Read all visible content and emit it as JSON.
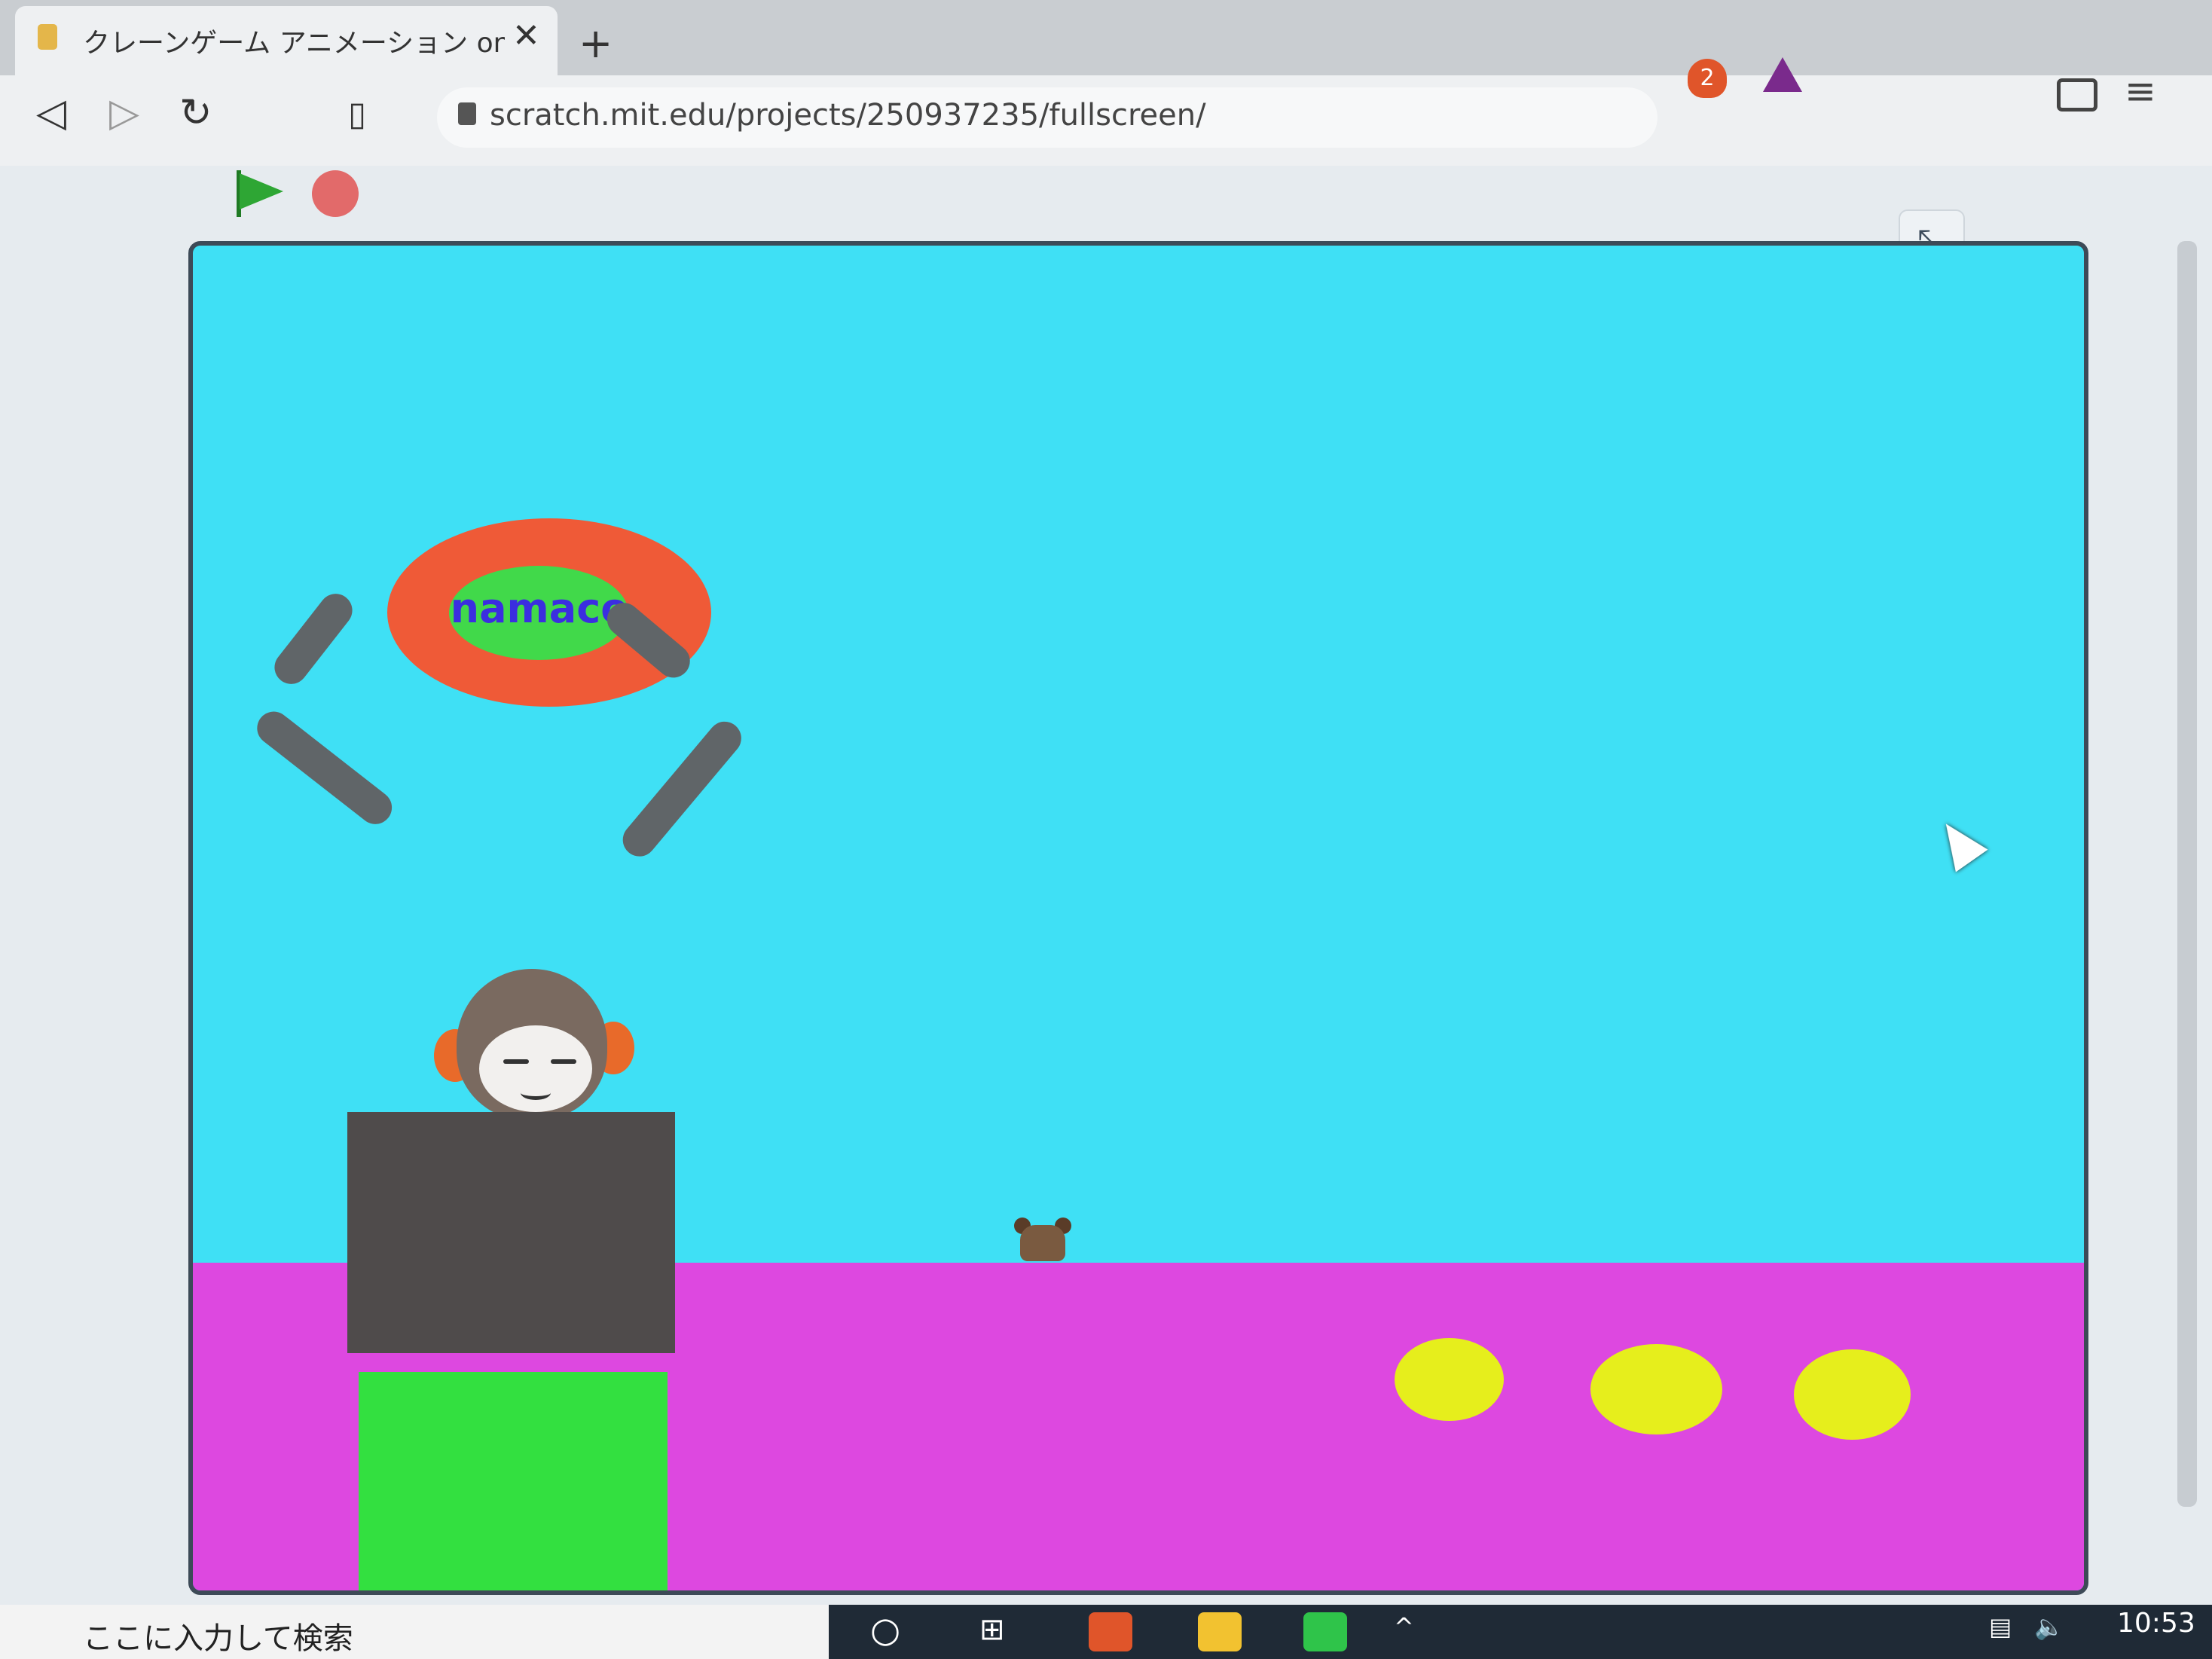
{
  "browser": {
    "tab_title": "クレーンゲーム アニメーション on Scra",
    "tab_close": "✕",
    "new_tab": "+",
    "url": "scratch.mit.edu/projects/250937235/fullscreen/",
    "extension_badge": "2"
  },
  "stage": {
    "claw_label": "namaco",
    "colors": {
      "sky": "#3fe0f5",
      "floor": "#dd48e0",
      "claw_base": "#ef5a37",
      "claw_badge": "#41d94a",
      "box_dark": "#4f4b4b",
      "box_green": "#33e040",
      "coin": "#e6ee1c"
    }
  },
  "taskbar": {
    "search_placeholder": "ここに入力して検索",
    "clock": "10:53"
  }
}
